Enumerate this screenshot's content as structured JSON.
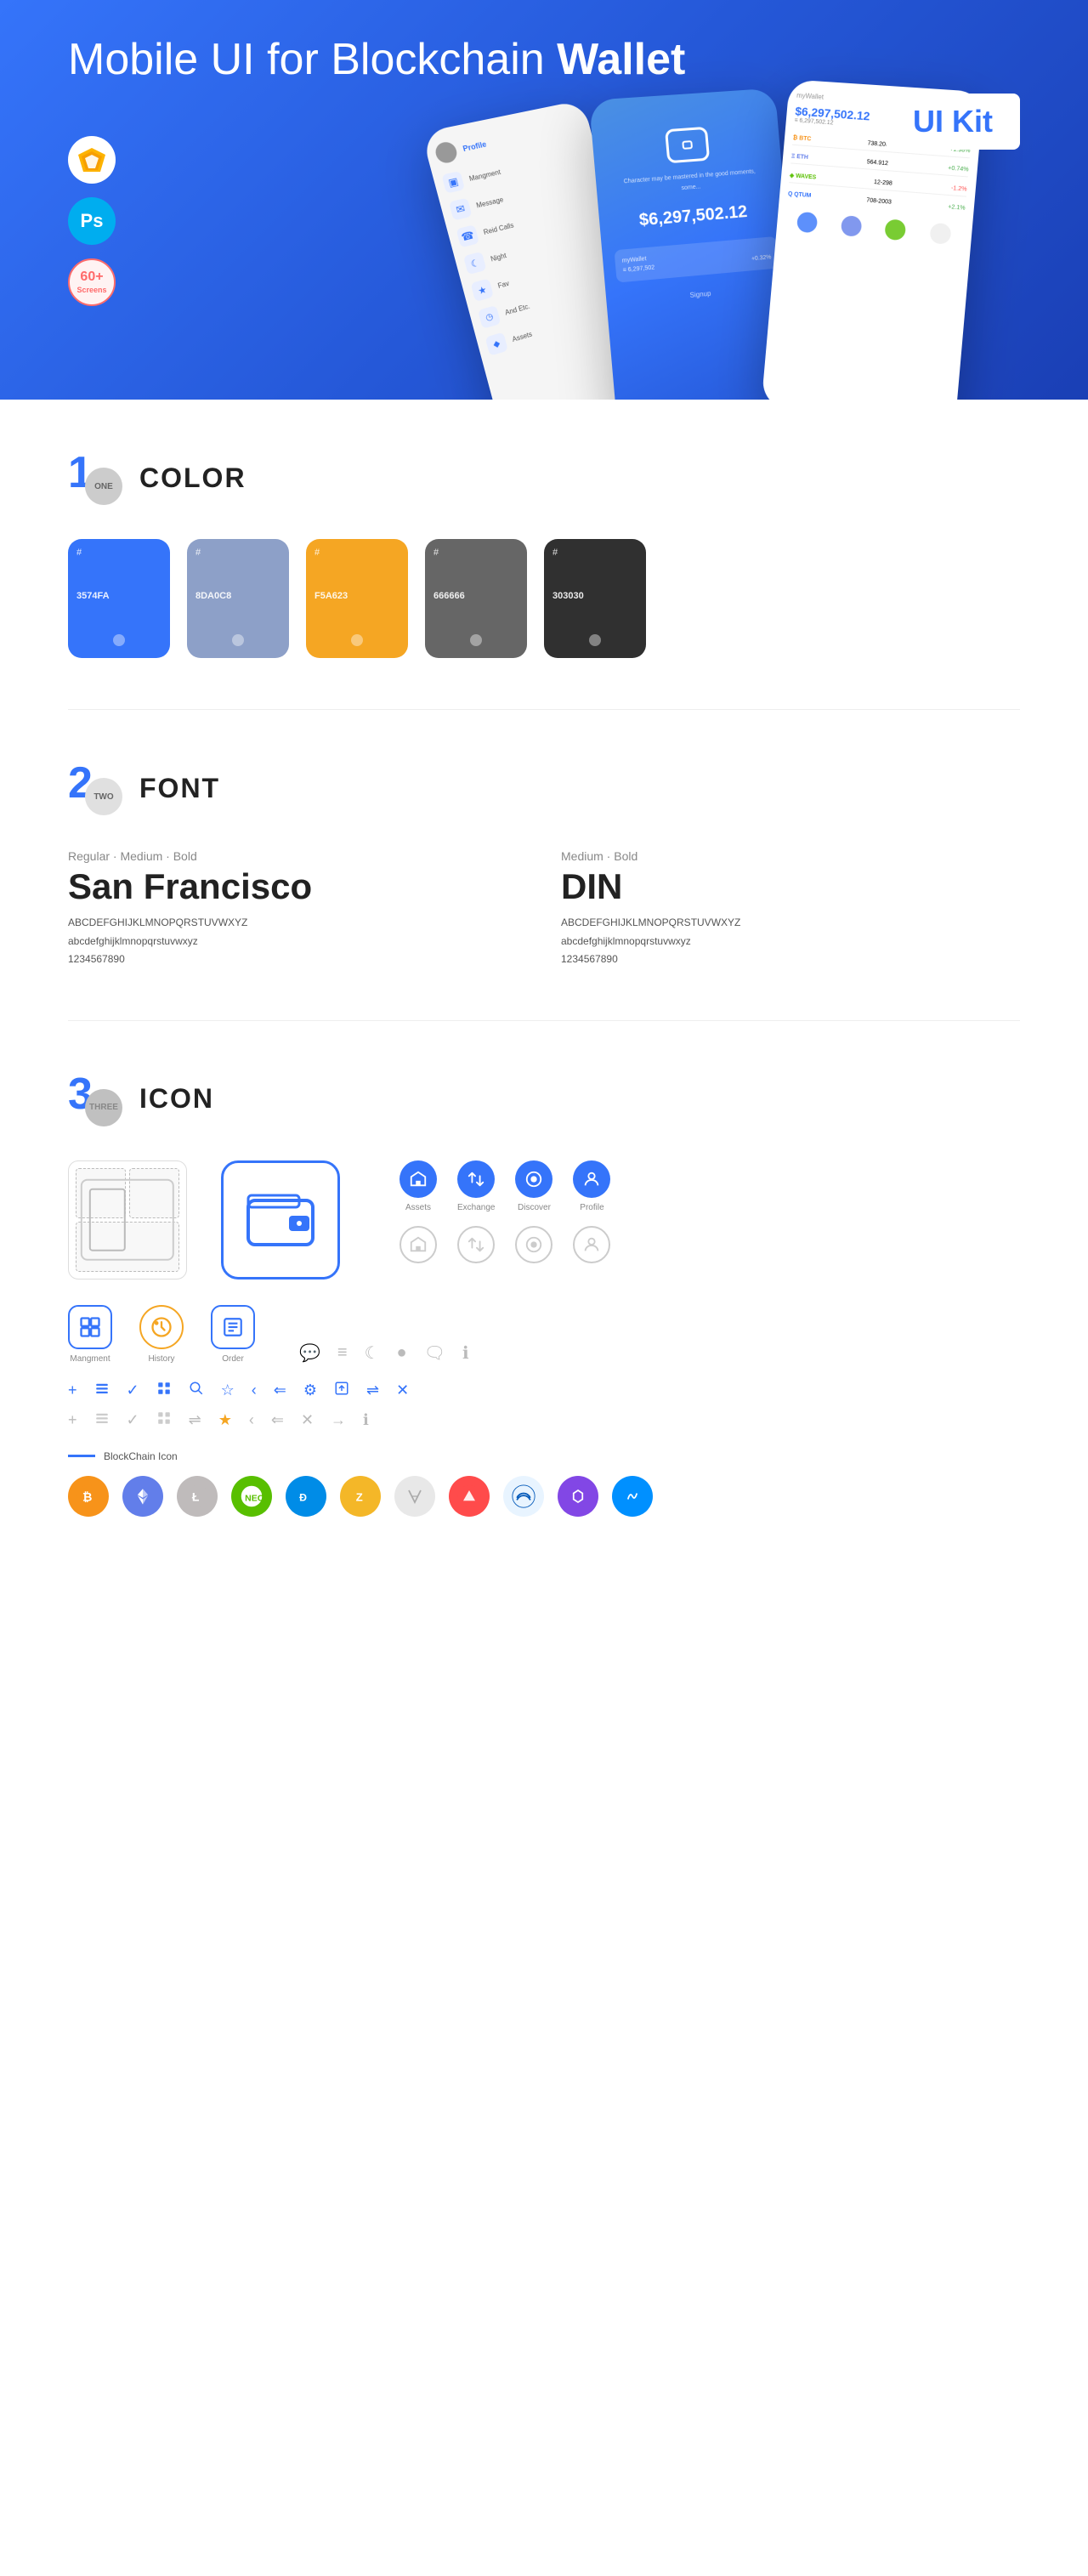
{
  "hero": {
    "title_regular": "Mobile UI for Blockchain ",
    "title_bold": "Wallet",
    "uikit_label": "UI Kit",
    "badge_sketch": "Sketch",
    "badge_ps": "Ps",
    "badge_screens": "60+\nScreens"
  },
  "sections": {
    "color": {
      "number": "1",
      "sublabel": "ONE",
      "title": "COLOR",
      "swatches": [
        {
          "hex": "#3574FA",
          "label": "#\n3574FA",
          "light": false
        },
        {
          "hex": "#8DA0C8",
          "label": "#\n8DA0C8",
          "light": false
        },
        {
          "hex": "#F5A623",
          "label": "#\nF5A623",
          "light": false
        },
        {
          "hex": "#666666",
          "label": "#\n666666",
          "light": false
        },
        {
          "hex": "#303030",
          "label": "#\n303030",
          "light": false
        }
      ]
    },
    "font": {
      "number": "2",
      "sublabel": "TWO",
      "title": "FONT",
      "fonts": [
        {
          "weight_label": "Regular · Medium · Bold",
          "name": "San Francisco",
          "uppercase": "ABCDEFGHIJKLMNOPQRSTUVWXYZ",
          "lowercase": "abcdefghijklmnopqrstuvwxyz",
          "numbers": "1234567890"
        },
        {
          "weight_label": "Medium · Bold",
          "name": "DIN",
          "uppercase": "ABCDEFGHIJKLMNOPQRSTUVWXYZ",
          "lowercase": "abcdefghijklmnopqrstuvwxyz",
          "numbers": "1234567890"
        }
      ]
    },
    "icon": {
      "number": "3",
      "sublabel": "THREE",
      "title": "ICON",
      "named_icons": [
        {
          "label": "Assets",
          "symbol": "◆"
        },
        {
          "label": "Exchange",
          "symbol": "⇄"
        },
        {
          "label": "Discover",
          "symbol": "●"
        },
        {
          "label": "Profile",
          "symbol": "👤"
        }
      ],
      "row_icons": [
        {
          "label": "Mangment",
          "symbol": "▣"
        },
        {
          "label": "History",
          "symbol": "◷"
        },
        {
          "label": "Order",
          "symbol": "≡"
        }
      ],
      "small_icons_row1": [
        "+",
        "☰",
        "✓",
        "⊞",
        "🔍",
        "☆",
        "‹",
        "⇐",
        "⚙",
        "⊡",
        "⇌",
        "✕"
      ],
      "small_icons_row2": [
        "+",
        "☰",
        "✓",
        "⊞",
        "⇌",
        "☆",
        "‹",
        "⇐",
        "✕",
        "→",
        "ℹ"
      ],
      "blockchain_label": "BlockChain Icon",
      "crypto_icons": [
        "₿",
        "Ξ",
        "Ł",
        "◈",
        "Đ",
        "Z",
        "◎",
        "Ψ",
        "◇",
        "●",
        "∞"
      ]
    }
  }
}
